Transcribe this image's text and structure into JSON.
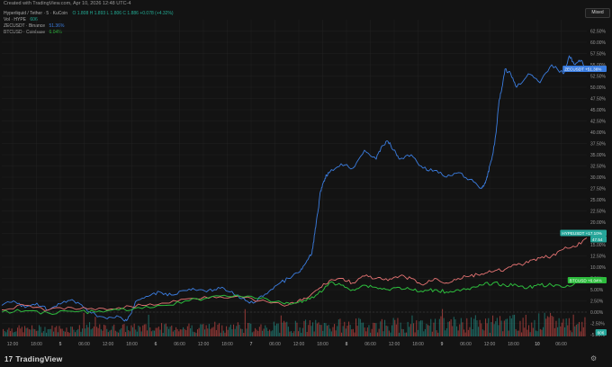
{
  "header": {
    "created_text": "Created with TradingView.com, Apr 10, 2026 12:48 UTC-4",
    "legend": {
      "symbol_line": "Hyperliquid / Tether · 5 · KuCoin",
      "ohlc": "O 1.808 H 1.893 L 1.806 C 1.886 +0.078 (+4.32%)",
      "volume_label": "Vol · HYPE",
      "volume_value": "606",
      "compare": [
        {
          "label": "ZECUSDT · Binance",
          "value": "51.36%",
          "color": "#3b7de0"
        },
        {
          "label": "BTCUSD · Coinbase",
          "value": "6.04%",
          "color": "#2dbc3d"
        }
      ]
    },
    "scale_button": "Mixed"
  },
  "colors": {
    "background": "#131313",
    "grid": "#232323",
    "zec": "#3b7de0",
    "hype_up": "#26a69a",
    "hype_down": "#ef5350",
    "btc": "#2dbc3d",
    "vol_up": "#26a69a",
    "vol_down": "#ef5350"
  },
  "chart_data": {
    "type": "line",
    "ylim": [
      -5,
      65
    ],
    "y_ticks": [
      -5,
      -2.5,
      0,
      2.5,
      5,
      7.5,
      10,
      12.5,
      15,
      17.5,
      20,
      22.5,
      25,
      27.5,
      30,
      32.5,
      35,
      37.5,
      40,
      42.5,
      45,
      47.5,
      50,
      52.5,
      55,
      57.5,
      60,
      62.5
    ],
    "y_tick_labels": [
      "-5.00%",
      "-2.50%",
      "0.00%",
      "2.50%",
      "5.00%",
      "7.50%",
      "10.00%",
      "12.50%",
      "15.00%",
      "17.50%",
      "20.00%",
      "22.50%",
      "25.00%",
      "27.50%",
      "30.00%",
      "32.50%",
      "35.00%",
      "37.50%",
      "40.00%",
      "42.50%",
      "45.00%",
      "47.50%",
      "50.00%",
      "52.50%",
      "55.00%",
      "57.50%",
      "60.00%",
      "62.50%"
    ],
    "x_ticks": [
      "12:00",
      "18:00",
      "5",
      "06:00",
      "12:00",
      "18:00",
      "6",
      "06:00",
      "12:00",
      "18:00",
      "7",
      "06:00",
      "12:00",
      "18:00",
      "8",
      "06:00",
      "12:00",
      "18:00",
      "9",
      "06:00",
      "12:00",
      "18:00",
      "10",
      "06:00",
      "12:00"
    ],
    "x_tick_pos": [
      0.02,
      0.075,
      0.128,
      0.182,
      0.236,
      0.29,
      0.344,
      0.398,
      0.452,
      0.506,
      0.56,
      0.614,
      0.668,
      0.722,
      0.776,
      0.83,
      0.884,
      0.938,
      0.992,
      1.046,
      1.1,
      1.154,
      1.208,
      1.262,
      1.316
    ],
    "series": [
      {
        "name": "ZECUSDT",
        "color": "#3b7de0",
        "x": [
          0,
          0.02,
          0.04,
          0.06,
          0.08,
          0.1,
          0.12,
          0.14,
          0.16,
          0.18,
          0.2,
          0.21,
          0.22,
          0.23,
          0.25,
          0.27,
          0.29,
          0.31,
          0.33,
          0.35,
          0.37,
          0.39,
          0.41,
          0.43,
          0.45,
          0.47,
          0.49,
          0.51,
          0.52,
          0.53,
          0.535,
          0.54,
          0.545,
          0.55,
          0.555,
          0.56,
          0.58,
          0.6,
          0.62,
          0.64,
          0.65,
          0.66,
          0.67,
          0.68,
          0.7,
          0.72,
          0.74,
          0.76,
          0.78,
          0.8,
          0.82,
          0.825,
          0.83,
          0.835,
          0.84,
          0.845,
          0.85,
          0.855,
          0.86,
          0.87,
          0.88,
          0.9,
          0.92,
          0.94,
          0.96,
          0.97,
          0.98,
          0.99,
          1.0
        ],
        "values": [
          1.5,
          2.5,
          1.0,
          2.0,
          0.5,
          1.8,
          2.8,
          1.0,
          -0.5,
          -1.5,
          -1.0,
          -2.0,
          -0.5,
          2.5,
          3.5,
          4.5,
          3.8,
          4.8,
          5.0,
          4.5,
          5.5,
          4.5,
          3.0,
          2.0,
          4.0,
          6.0,
          7.5,
          9.0,
          11.0,
          13.0,
          17.5,
          22.0,
          27.0,
          29.0,
          30.5,
          31.0,
          33.0,
          32.0,
          36.0,
          34.0,
          37.0,
          38.0,
          36.0,
          34.0,
          35.0,
          32.0,
          31.5,
          30.0,
          31.0,
          29.5,
          27.5,
          28.5,
          30.0,
          33.0,
          35.5,
          40.0,
          47.0,
          50.0,
          54.0,
          53.0,
          50.0,
          53.0,
          51.0,
          55.0,
          53.0,
          57.0,
          55.0,
          56.0,
          54.0
        ]
      },
      {
        "name": "HYPEUSDT",
        "color": "#e57373",
        "x": [
          0,
          0.04,
          0.08,
          0.12,
          0.16,
          0.2,
          0.24,
          0.28,
          0.32,
          0.36,
          0.4,
          0.44,
          0.48,
          0.5,
          0.52,
          0.54,
          0.56,
          0.58,
          0.6,
          0.62,
          0.64,
          0.66,
          0.68,
          0.7,
          0.72,
          0.74,
          0.76,
          0.78,
          0.8,
          0.82,
          0.84,
          0.86,
          0.88,
          0.9,
          0.92,
          0.94,
          0.96,
          0.98,
          1.0
        ],
        "values": [
          0.5,
          1.5,
          0.5,
          1.0,
          0.5,
          1.0,
          1.5,
          2.0,
          3.0,
          3.5,
          3.5,
          2.5,
          1.5,
          2.0,
          3.0,
          5.0,
          7.0,
          7.5,
          6.5,
          8.0,
          7.5,
          7.0,
          8.0,
          7.5,
          6.0,
          7.5,
          6.5,
          7.5,
          8.0,
          8.5,
          9.0,
          9.5,
          10.5,
          11.0,
          12.0,
          12.5,
          14.0,
          14.5,
          16.5
        ]
      },
      {
        "name": "BTCUSD",
        "color": "#2dbc3d",
        "x": [
          0,
          0.04,
          0.08,
          0.12,
          0.16,
          0.2,
          0.24,
          0.28,
          0.32,
          0.36,
          0.4,
          0.44,
          0.48,
          0.5,
          0.52,
          0.54,
          0.56,
          0.58,
          0.6,
          0.62,
          0.64,
          0.66,
          0.68,
          0.7,
          0.72,
          0.74,
          0.76,
          0.78,
          0.8,
          0.82,
          0.84,
          0.86,
          0.88,
          0.9,
          0.92,
          0.94,
          0.96,
          0.98,
          1.0
        ],
        "values": [
          0.0,
          0.3,
          -0.2,
          0.2,
          0.0,
          0.5,
          0.8,
          1.5,
          2.5,
          3.5,
          3.8,
          3.0,
          2.0,
          2.0,
          2.5,
          4.0,
          6.5,
          6.0,
          5.0,
          6.0,
          5.5,
          5.0,
          5.5,
          5.0,
          4.5,
          5.0,
          4.5,
          5.0,
          5.0,
          6.0,
          6.5,
          6.0,
          6.0,
          5.5,
          6.0,
          6.0,
          5.5,
          6.5,
          7.0
        ]
      }
    ],
    "price_labels": [
      {
        "text": "ZECUSDT  +51.36%",
        "color": "#3b7de0"
      },
      {
        "text": "HYPEUSDT  +17.10%",
        "color": "#26a69a"
      },
      {
        "text": "47.54",
        "color": "#26a69a"
      },
      {
        "text": "BTCUSD  +6.04%",
        "color": "#2dbc3d"
      },
      {
        "text": "606",
        "color": "#26a69a"
      }
    ]
  },
  "footer": {
    "logo_text": "TradingView",
    "logo_mark": "17",
    "settings_icon": "gear-icon"
  }
}
